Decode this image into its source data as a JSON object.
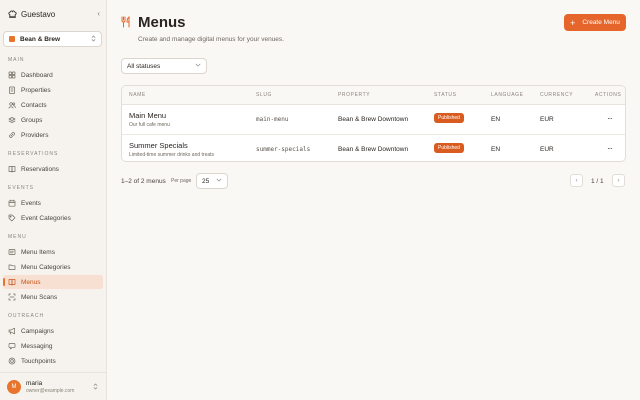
{
  "app": {
    "name": "Guestavo",
    "collapse_icon": "‹"
  },
  "venue": {
    "name": "Bean & Brew",
    "caret": "⌃⌄"
  },
  "sidebar": {
    "sections": [
      {
        "label": "MAIN",
        "items": [
          {
            "label": "Dashboard",
            "icon": "grid-icon"
          },
          {
            "label": "Properties",
            "icon": "building-icon"
          },
          {
            "label": "Contacts",
            "icon": "users-icon"
          },
          {
            "label": "Groups",
            "icon": "group-icon"
          },
          {
            "label": "Providers",
            "icon": "link-icon"
          }
        ]
      },
      {
        "label": "RESERVATIONS",
        "items": [
          {
            "label": "Reservations",
            "icon": "book-icon"
          }
        ]
      },
      {
        "label": "EVENTS",
        "items": [
          {
            "label": "Events",
            "icon": "calendar-icon"
          },
          {
            "label": "Event Categories",
            "icon": "tag-icon"
          }
        ]
      },
      {
        "label": "MENU",
        "items": [
          {
            "label": "Menu Items",
            "icon": "list-icon"
          },
          {
            "label": "Menu Categories",
            "icon": "folder-icon"
          },
          {
            "label": "Menus",
            "icon": "book-open-icon",
            "active": true
          },
          {
            "label": "Menu Scans",
            "icon": "scan-icon"
          }
        ]
      },
      {
        "label": "OUTREACH",
        "items": [
          {
            "label": "Campaigns",
            "icon": "megaphone-icon"
          },
          {
            "label": "Messaging",
            "icon": "message-icon"
          },
          {
            "label": "Touchpoints",
            "icon": "target-icon"
          }
        ]
      }
    ]
  },
  "user": {
    "initial": "M",
    "name": "maria",
    "email": "owner@example.com"
  },
  "page": {
    "title": "Menus",
    "subtitle": "Create and manage digital menus for your venues.",
    "create_label": "Create Menu",
    "create_plus": "+"
  },
  "filter": {
    "label": "All statuses",
    "caret": "⌄"
  },
  "table": {
    "columns": [
      "NAME",
      "SLUG",
      "PROPERTY",
      "STATUS",
      "LANGUAGE",
      "CURRENCY",
      "ACTIONS"
    ],
    "rows": [
      {
        "name": "Main Menu",
        "description": "Our full cafe menu",
        "slug": "main-menu",
        "property": "Bean & Brew Downtown",
        "status": "Published",
        "language": "EN",
        "currency": "EUR",
        "actions": "···"
      },
      {
        "name": "Summer Specials",
        "description": "Limited-time summer drinks and treats",
        "slug": "summer-specials",
        "property": "Bean & Brew Downtown",
        "status": "Published",
        "language": "EN",
        "currency": "EUR",
        "actions": "···"
      }
    ]
  },
  "pagination": {
    "count_text": "1–2 of 2 menus",
    "per_page_label": "Per page",
    "per_page_value": "25",
    "per_page_caret": "⌄",
    "prev": "‹",
    "next": "›",
    "page_info": "1 / 1"
  },
  "colors": {
    "accent": "#e5652a",
    "badge": "#d95b1f",
    "sidebar_bg": "#f6f3ee",
    "page_bg": "#faf8f5"
  }
}
